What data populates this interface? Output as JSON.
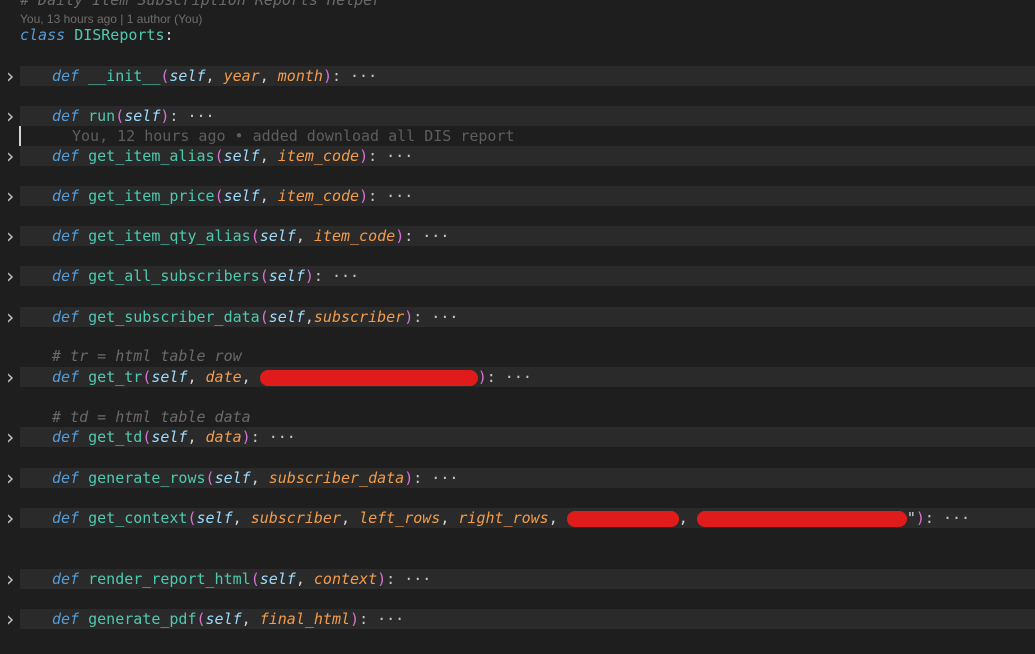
{
  "header": {
    "top_comment": "# Daily Item Subscription Reports Helper",
    "blame": "You, 13 hours ago | 1 author (You)",
    "class_kw": "class",
    "class_name": "DISReports",
    "colon": ":"
  },
  "inline_blame": "You, 12 hours ago • added download all DIS report",
  "comments": {
    "tr": "# tr = html table row",
    "td": "# td = html table data"
  },
  "defs": [
    {
      "kw": "def",
      "name": "__init__",
      "params": [
        {
          "t": "self",
          "k": "self"
        },
        {
          "t": ", ",
          "k": "punct"
        },
        {
          "t": "year",
          "k": "param"
        },
        {
          "t": ", ",
          "k": "punct"
        },
        {
          "t": "month",
          "k": "param"
        }
      ],
      "tail": ": ···"
    },
    {
      "kw": "def",
      "name": "run",
      "params": [
        {
          "t": "self",
          "k": "self"
        }
      ],
      "tail": ": ···"
    },
    {
      "kw": "def",
      "name": "get_item_alias",
      "params": [
        {
          "t": "self",
          "k": "self"
        },
        {
          "t": ", ",
          "k": "punct"
        },
        {
          "t": "item_code",
          "k": "param"
        }
      ],
      "tail": ": ···"
    },
    {
      "kw": "def",
      "name": "get_item_price",
      "params": [
        {
          "t": "self",
          "k": "self"
        },
        {
          "t": ", ",
          "k": "punct"
        },
        {
          "t": "item_code",
          "k": "param"
        }
      ],
      "tail": ": ···"
    },
    {
      "kw": "def",
      "name": "get_item_qty_alias",
      "params": [
        {
          "t": "self",
          "k": "self"
        },
        {
          "t": ", ",
          "k": "punct"
        },
        {
          "t": "item_code",
          "k": "param"
        }
      ],
      "tail": ": ···"
    },
    {
      "kw": "def",
      "name": "get_all_subscribers",
      "params": [
        {
          "t": "self",
          "k": "self"
        }
      ],
      "tail": ": ···"
    },
    {
      "kw": "def",
      "name": "get_subscriber_data",
      "params": [
        {
          "t": "self",
          "k": "self"
        },
        {
          "t": ",",
          "k": "punct"
        },
        {
          "t": "subscriber",
          "k": "param"
        }
      ],
      "tail": ": ···"
    },
    {
      "kw": "def",
      "name": "get_tr",
      "params": [
        {
          "t": "self",
          "k": "self"
        },
        {
          "t": ", ",
          "k": "punct"
        },
        {
          "t": "date",
          "k": "param"
        },
        {
          "t": ", ",
          "k": "punct"
        },
        {
          "t": "",
          "k": "redact"
        }
      ],
      "tail": ": ···"
    },
    {
      "kw": "def",
      "name": "get_td",
      "params": [
        {
          "t": "self",
          "k": "self"
        },
        {
          "t": ", ",
          "k": "punct"
        },
        {
          "t": "data",
          "k": "param"
        }
      ],
      "tail": ": ···"
    },
    {
      "kw": "def",
      "name": "generate_rows",
      "params": [
        {
          "t": "self",
          "k": "self"
        },
        {
          "t": ", ",
          "k": "punct"
        },
        {
          "t": "subscriber_data",
          "k": "param"
        }
      ],
      "tail": ": ···"
    },
    {
      "kw": "def",
      "name": "get_context",
      "params": [
        {
          "t": "self",
          "k": "self"
        },
        {
          "t": ", ",
          "k": "punct"
        },
        {
          "t": "subscriber",
          "k": "param"
        },
        {
          "t": ", ",
          "k": "punct"
        },
        {
          "t": "left_rows",
          "k": "param"
        },
        {
          "t": ", ",
          "k": "punct"
        },
        {
          "t": "right_rows",
          "k": "param"
        },
        {
          "t": ", ",
          "k": "punct"
        },
        {
          "t": "",
          "k": "redact"
        },
        {
          "t": ", ",
          "k": "punct"
        },
        {
          "t": "",
          "k": "redact"
        },
        {
          "t": "\"",
          "k": "punct"
        }
      ],
      "tail": ": ···"
    },
    {
      "kw": "def",
      "name": "render_report_html",
      "params": [
        {
          "t": "self",
          "k": "self"
        },
        {
          "t": ", ",
          "k": "punct"
        },
        {
          "t": "context",
          "k": "param"
        }
      ],
      "tail": ": ···"
    },
    {
      "kw": "def",
      "name": "generate_pdf",
      "params": [
        {
          "t": "self",
          "k": "self"
        },
        {
          "t": ", ",
          "k": "punct"
        },
        {
          "t": "final_html",
          "k": "param"
        }
      ],
      "tail": ": ···"
    }
  ],
  "fold_icon": "chevron-right-icon"
}
